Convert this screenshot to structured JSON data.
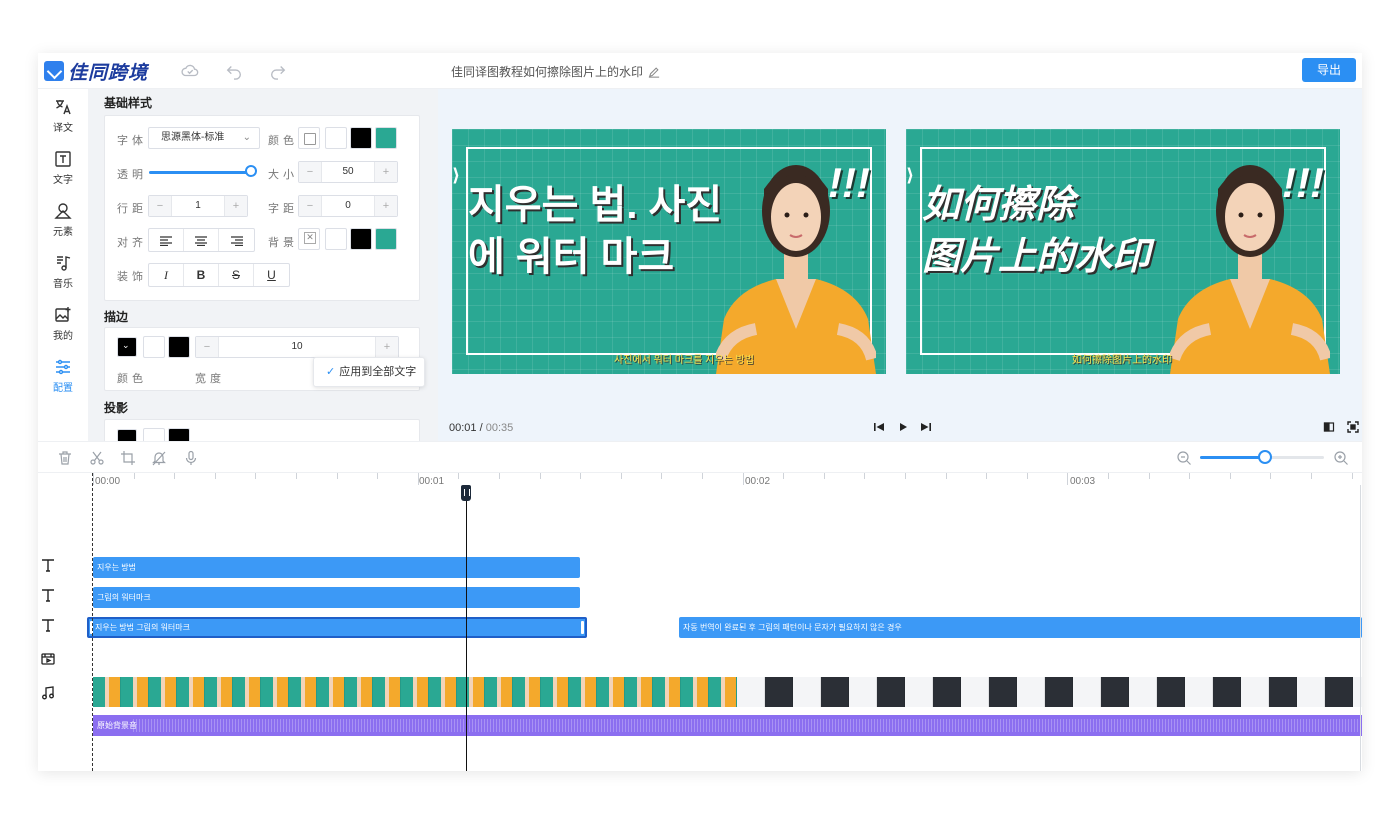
{
  "header": {
    "logo_text": "佳同跨境",
    "title": "佳同译图教程如何擦除图片上的水印",
    "export_label": "导出"
  },
  "leftnav": {
    "items": [
      {
        "label": "译文",
        "icon": "translate-icon"
      },
      {
        "label": "文字",
        "icon": "text-icon"
      },
      {
        "label": "元素",
        "icon": "element-icon"
      },
      {
        "label": "音乐",
        "icon": "music-icon"
      },
      {
        "label": "我的",
        "icon": "my-images-icon"
      },
      {
        "label": "配置",
        "icon": "settings-icon",
        "active": true
      }
    ]
  },
  "panel": {
    "basic_title": "基础样式",
    "font_label": "字体",
    "font_value": "思源黑体-标准",
    "color_label": "颜色",
    "opacity_label": "透明",
    "opacity_fraction": 1.0,
    "size_label": "大小",
    "size_value": "50",
    "line_height_label": "行距",
    "line_height_value": "1",
    "letter_spacing_label": "字距",
    "letter_spacing_value": "0",
    "align_label": "对齐",
    "background_label": "背景",
    "decoration_label": "装饰",
    "decoration_buttons": [
      "I",
      "B",
      "S",
      "U"
    ],
    "stroke_title": "描边",
    "stroke_color_label": "颜色",
    "stroke_width_label": "宽度",
    "stroke_width_value": "10",
    "shadow_title": "投影",
    "apply_all_label": "应用到全部文字",
    "accent_colors": {
      "black": "#000000",
      "teal": "#2aa893",
      "white": "#ffffff"
    }
  },
  "preview": {
    "left_frame": {
      "headline": "지우는 법. 사진\n에 워터 마크",
      "exclaim": "!!!",
      "subtitle": "사진에서 워터 마크를 지우는 방법"
    },
    "right_frame": {
      "headline": "如何擦除\n图片上的水印",
      "exclaim": "!!!",
      "subtitle": "如何擦除图片上的水印"
    },
    "current_time": "00:01",
    "separator": "/",
    "total_time": "00:35"
  },
  "timeline": {
    "ruler": [
      "00:00",
      "00:01",
      "00:02",
      "00:03"
    ],
    "zoom_fraction": 0.5,
    "text_tracks": [
      {
        "clips": [
          {
            "label": "지우는 방법"
          }
        ]
      },
      {
        "clips": [
          {
            "label": "그림의 워터마크"
          }
        ]
      },
      {
        "clips": [
          {
            "label": "지우는 방법 그림의 워터마크",
            "selected": true
          },
          {
            "label": "자동 번역이 완료된 후 그림의 패턴이나 문자가 필요하지 않은 경우"
          }
        ]
      }
    ],
    "audio_label": "原始背景音"
  }
}
